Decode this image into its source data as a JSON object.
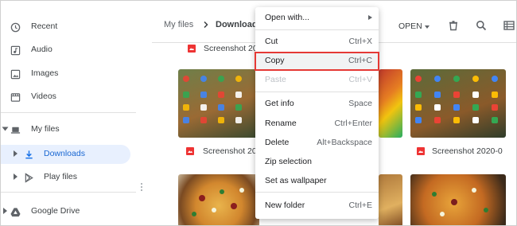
{
  "sidebar": {
    "items": [
      {
        "label": "Recent",
        "icon": "clock-icon"
      },
      {
        "label": "Audio",
        "icon": "audio-icon"
      },
      {
        "label": "Images",
        "icon": "image-icon"
      },
      {
        "label": "Videos",
        "icon": "video-icon"
      },
      {
        "label": "My files",
        "icon": "laptop-icon"
      },
      {
        "label": "Downloads",
        "icon": "download-icon"
      },
      {
        "label": "Play files",
        "icon": "play-store-icon"
      },
      {
        "label": "Google Drive",
        "icon": "drive-icon"
      }
    ]
  },
  "header": {
    "breadcrumb_root": "My files",
    "breadcrumb_current": "Downloads",
    "open_label": "OPEN"
  },
  "files": {
    "top_partial": "Screenshot 202",
    "row2_left": "Screenshot 202",
    "row2_right": "Screenshot 2020-0"
  },
  "context_menu": {
    "items": [
      {
        "label": "Open with...",
        "shortcut": ""
      },
      {
        "label": "Cut",
        "shortcut": "Ctrl+X"
      },
      {
        "label": "Copy",
        "shortcut": "Ctrl+C"
      },
      {
        "label": "Paste",
        "shortcut": "Ctrl+V"
      },
      {
        "label": "Get info",
        "shortcut": "Space"
      },
      {
        "label": "Rename",
        "shortcut": "Ctrl+Enter"
      },
      {
        "label": "Delete",
        "shortcut": "Alt+Backspace"
      },
      {
        "label": "Zip selection",
        "shortcut": ""
      },
      {
        "label": "Set as wallpaper",
        "shortcut": ""
      },
      {
        "label": "New folder",
        "shortcut": "Ctrl+E"
      }
    ]
  },
  "colors": {
    "accent": "#1a73e8",
    "highlight_border": "#e53935",
    "active_bg": "#e8f0fe"
  }
}
